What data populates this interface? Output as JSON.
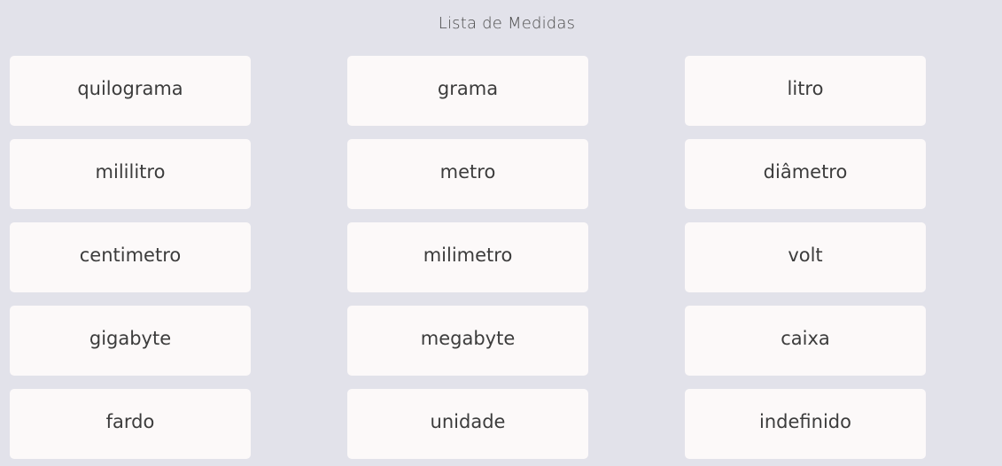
{
  "header": {
    "title": "Lista de Medidas"
  },
  "units": [
    {
      "label": "quilograma"
    },
    {
      "label": "grama"
    },
    {
      "label": "litro"
    },
    {
      "label": "mililitro"
    },
    {
      "label": "metro"
    },
    {
      "label": "diâmetro"
    },
    {
      "label": "centimetro"
    },
    {
      "label": "milimetro"
    },
    {
      "label": "volt"
    },
    {
      "label": "gigabyte"
    },
    {
      "label": "megabyte"
    },
    {
      "label": "caixa"
    },
    {
      "label": "fardo"
    },
    {
      "label": "unidade"
    },
    {
      "label": "indefinido"
    }
  ],
  "colors": {
    "background": "#e2e2ea",
    "card": "#fcf9f9",
    "text": "#3c3c3c"
  }
}
